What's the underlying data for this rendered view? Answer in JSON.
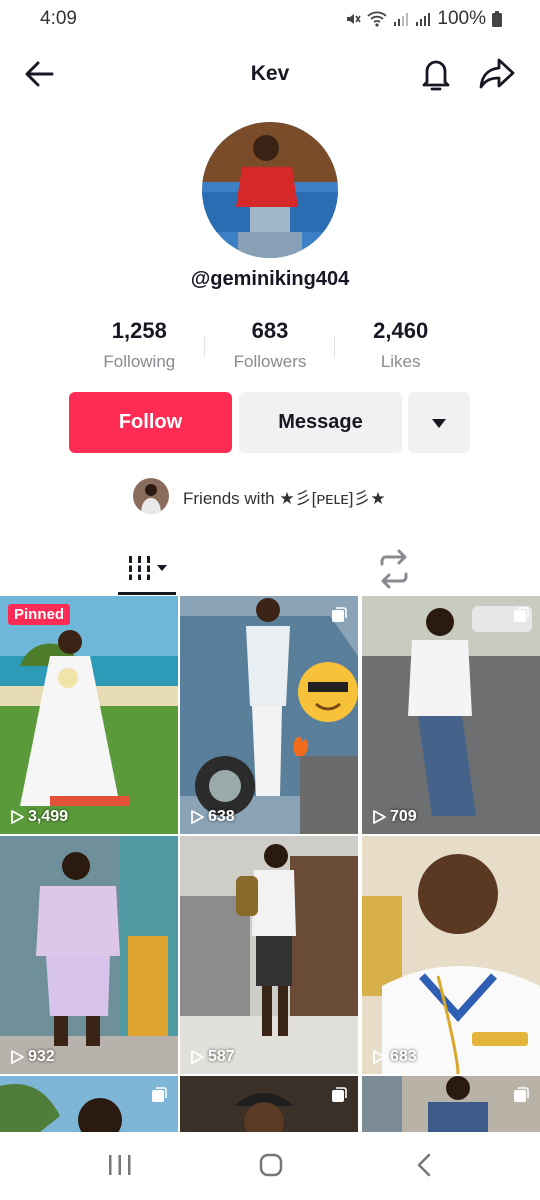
{
  "status": {
    "time": "4:09",
    "battery": "100%"
  },
  "header": {
    "title": "Kev"
  },
  "profile": {
    "username": "@geminiking404",
    "stats": [
      {
        "value": "1,258",
        "label": "Following"
      },
      {
        "value": "683",
        "label": "Followers"
      },
      {
        "value": "2,460",
        "label": "Likes"
      }
    ]
  },
  "actions": {
    "follow": "Follow",
    "message": "Message"
  },
  "friends": {
    "text": "Friends with ★彡[ᴘᴇʟᴇ]彡★"
  },
  "videos": [
    {
      "views": "3,499",
      "pinned": "Pinned"
    },
    {
      "views": "638"
    },
    {
      "views": "709"
    },
    {
      "views": "932"
    },
    {
      "views": "587"
    },
    {
      "views": "683"
    }
  ],
  "colors": {
    "accent": "#fe2c55",
    "text": "#161823",
    "muted": "#8a8b91",
    "button_bg": "#f1f1f2"
  }
}
